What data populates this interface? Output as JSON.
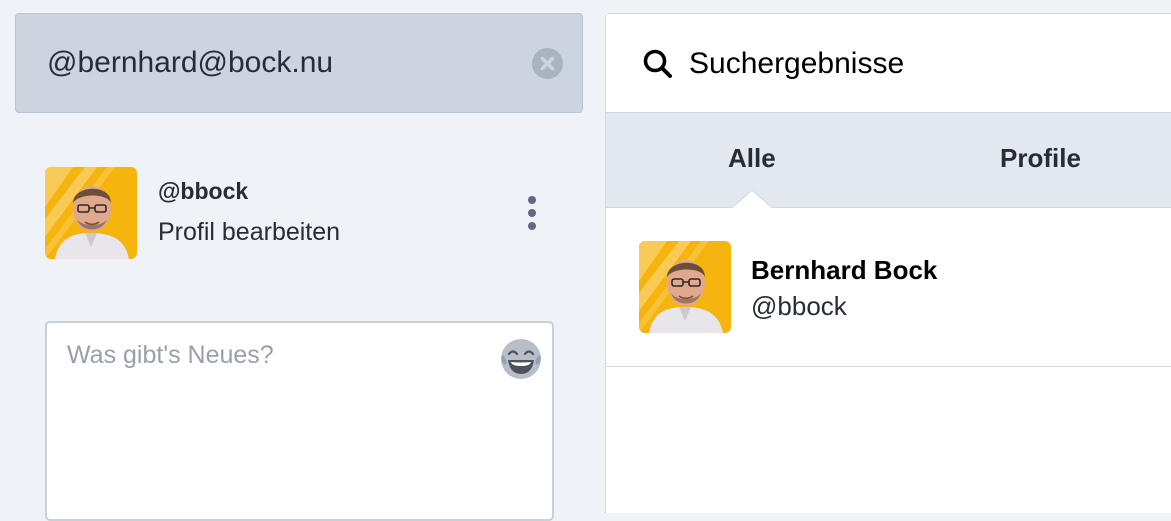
{
  "search": {
    "value": "@bernhard@bock.nu",
    "clear_icon": "close-circle-icon"
  },
  "account": {
    "handle": "@bbock",
    "edit_label": "Profil bearbeiten",
    "menu_icon": "kebab-menu-icon"
  },
  "compose": {
    "placeholder": "Was gibt's Neues?",
    "emoji_icon": "laughing-emoji-icon"
  },
  "results": {
    "header_icon": "search-icon",
    "title": "Suchergebnisse",
    "tabs": [
      {
        "label": "Alle",
        "active": true
      },
      {
        "label": "Profile",
        "active": false
      }
    ],
    "items": [
      {
        "display_name": "Bernhard Bock",
        "handle": "@bbock"
      }
    ]
  },
  "colors": {
    "background": "#eff2f6",
    "search_box": "#ccd5df",
    "tab_bar": "#e3e8ee",
    "avatar_bg": "#f6b40e",
    "text_primary": "#282c37"
  }
}
